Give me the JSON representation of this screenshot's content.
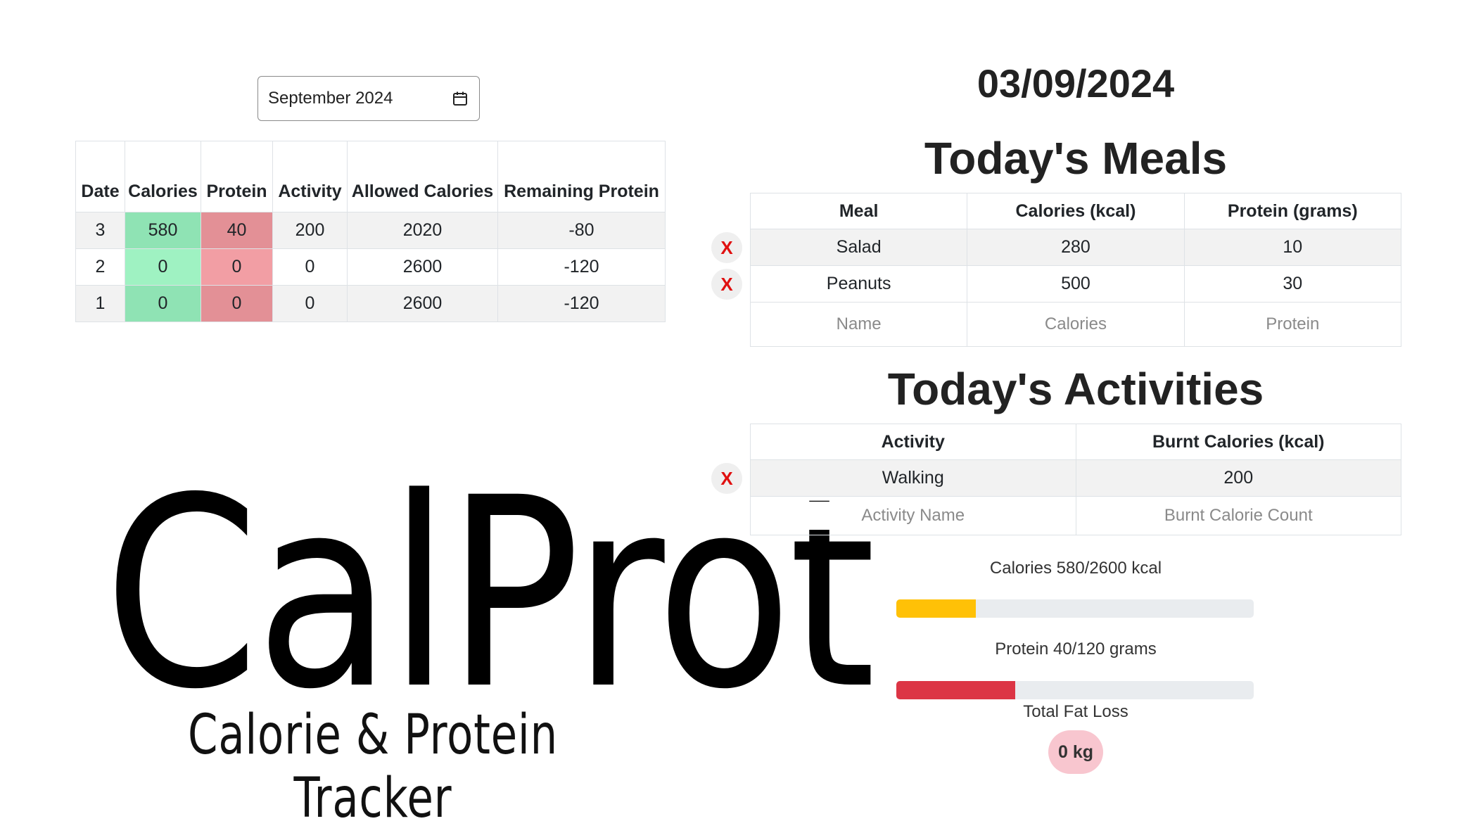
{
  "month_picker": {
    "value": "September 2024",
    "icon": "calendar-icon"
  },
  "history": {
    "headers": [
      "Date",
      "Calories",
      "Protein",
      "Activity",
      "Allowed Calories",
      "Remaining Protein"
    ],
    "rows": [
      [
        "3",
        "580",
        "40",
        "200",
        "2020",
        "-80"
      ],
      [
        "2",
        "0",
        "0",
        "0",
        "2600",
        "-120"
      ],
      [
        "1",
        "0",
        "0",
        "0",
        "2600",
        "-120"
      ]
    ],
    "colors": {
      "calories": "#8fe3b4",
      "protein": "#e39096"
    }
  },
  "logo": {
    "title": "CalProt",
    "tagline": "Calorie & Protein Tracker"
  },
  "selected_date": "03/09/2024",
  "meals": {
    "title": "Today's Meals",
    "headers": [
      "Meal",
      "Calories (kcal)",
      "Protein (grams)"
    ],
    "rows": [
      [
        "Salad",
        "280",
        "10"
      ],
      [
        "Peanuts",
        "500",
        "30"
      ]
    ],
    "placeholders": [
      "Name",
      "Calories",
      "Protein"
    ],
    "delete_label": "X"
  },
  "activities": {
    "title": "Today's Activities",
    "headers": [
      "Activity",
      "Burnt Calories (kcal)"
    ],
    "rows": [
      [
        "Walking",
        "200"
      ]
    ],
    "placeholders": [
      "Activity Name",
      "Burnt Calorie Count"
    ],
    "delete_label": "X"
  },
  "progress": {
    "calories": {
      "label": "Calories 580/2600 kcal",
      "fraction": 0.223,
      "color": "#ffc107"
    },
    "protein": {
      "label": "Protein 40/120 grams",
      "fraction": 0.333,
      "color": "#dc3545"
    }
  },
  "fat_loss": {
    "label": "Total Fat Loss",
    "value": "0 kg",
    "color": "#f8c6cf"
  }
}
